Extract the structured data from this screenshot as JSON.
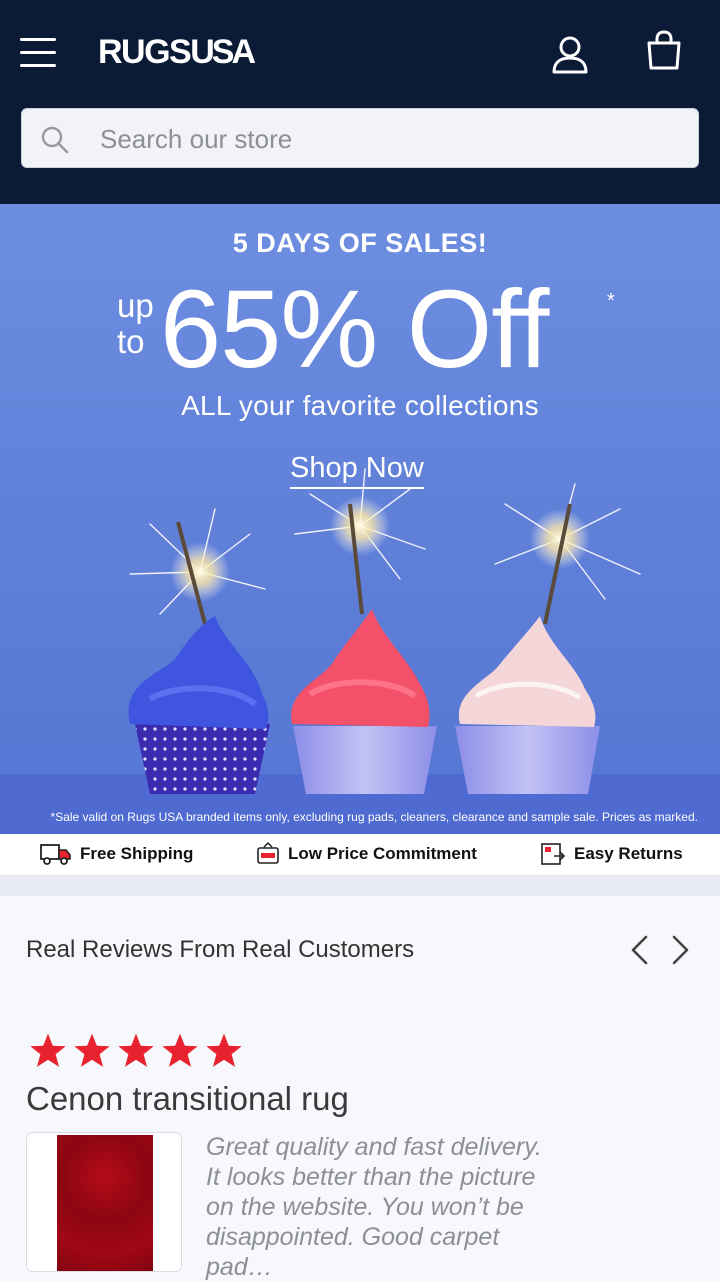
{
  "header": {
    "logo_left": "RUGS",
    "logo_right": "USA",
    "search_placeholder": "Search our store",
    "menu_icon": "hamburger-icon",
    "account_icon": "user-icon",
    "cart_icon": "shopping-bag-icon"
  },
  "hero": {
    "kicker": "5 DAYS OF SALES!",
    "up": "up",
    "to": "to",
    "headline": "65% Off",
    "asterisk": "*",
    "subhead": "ALL your favorite collections",
    "cta": "Shop Now",
    "disclaimer": "*Sale valid on Rugs USA branded items only, excluding rug pads, cleaners, clearance and sample sale. Prices as marked."
  },
  "benefits": [
    {
      "label": "Free Shipping",
      "icon": "truck-icon"
    },
    {
      "label": "Low Price Commitment",
      "icon": "sale-tag-icon"
    },
    {
      "label": "Easy Returns",
      "icon": "returns-box-icon"
    }
  ],
  "reviews": {
    "title": "Real Reviews From Real Customers",
    "rating": 5,
    "product": "Cenon transitional rug",
    "text": "Great quality and fast delivery. It looks better than the picture on the website. You won’t be disappointed. Good carpet pad…"
  },
  "colors": {
    "header_bg": "#0c1b35",
    "hero_bg": "#6d8ee0",
    "star": "#e8232f",
    "frosting_blue": "#3f55e0",
    "frosting_pink": "#f3516a",
    "frosting_cream": "#f4d6d8"
  }
}
